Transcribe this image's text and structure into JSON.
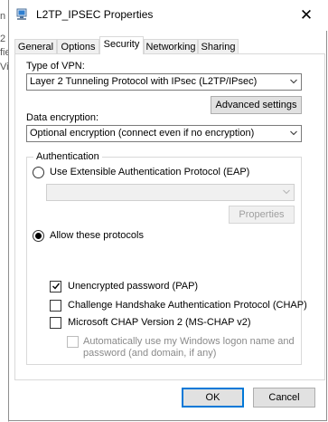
{
  "background_window": {
    "fragments": [
      "n",
      "2",
      "fie",
      "Vi"
    ]
  },
  "dialog": {
    "title": "L2TP_IPSEC Properties",
    "close_glyph": "✕"
  },
  "tabs": [
    {
      "label": "General",
      "active": false
    },
    {
      "label": "Options",
      "active": false
    },
    {
      "label": "Security",
      "active": true
    },
    {
      "label": "Networking",
      "active": false
    },
    {
      "label": "Sharing",
      "active": false
    }
  ],
  "security": {
    "vpn_type_label": "Type of VPN:",
    "vpn_type_value": "Layer 2 Tunneling Protocol with IPsec (L2TP/IPsec)",
    "advanced_settings_label": "Advanced settings",
    "data_encryption_label": "Data encryption:",
    "data_encryption_value": "Optional encryption (connect even if no encryption)",
    "authentication": {
      "legend": "Authentication",
      "eap_option_label": "Use Extensible Authentication Protocol (EAP)",
      "eap_selected": false,
      "eap_combo_value": "",
      "properties_label": "Properties",
      "allow_protocols_label": "Allow these protocols",
      "allow_protocols_selected": true,
      "protocols": [
        {
          "label": "Unencrypted password (PAP)",
          "checked": true,
          "enabled": true
        },
        {
          "label": "Challenge Handshake Authentication Protocol (CHAP)",
          "checked": false,
          "enabled": true
        },
        {
          "label": "Microsoft CHAP Version 2 (MS-CHAP v2)",
          "checked": false,
          "enabled": true
        }
      ],
      "auto_logon_line1": "Automatically use my Windows logon name and",
      "auto_logon_line2": "password (and domain, if any)",
      "auto_logon_checked": false
    }
  },
  "buttons": {
    "ok": "OK",
    "cancel": "Cancel"
  },
  "colors": {
    "accent": "#0078d7",
    "disabled_text": "#8a8a8a"
  }
}
